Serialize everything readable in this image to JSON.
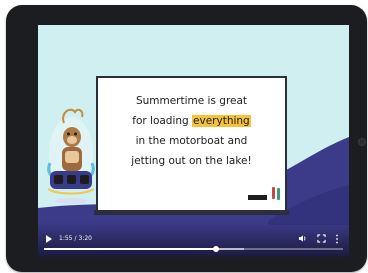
{
  "video": {
    "caption_lines": [
      {
        "before": "Summertime is great",
        "highlight": "",
        "after": ""
      },
      {
        "before": "for loading ",
        "highlight": "everything",
        "after": ""
      },
      {
        "before": "in the motorboat and",
        "highlight": "",
        "after": ""
      },
      {
        "before": "jetting out on the lake!",
        "highlight": "",
        "after": ""
      }
    ],
    "highlight_color": "#f6c23a",
    "background_color": "#cfeff1"
  },
  "player": {
    "current_time": "1:55",
    "separator": "/",
    "duration": "3:20",
    "progress_fraction": 0.575,
    "buffered_fraction": 0.67,
    "icons": {
      "play": "play-icon",
      "volume": "volume-icon",
      "fullscreen": "fullscreen-icon",
      "more": "more-options-icon"
    }
  }
}
